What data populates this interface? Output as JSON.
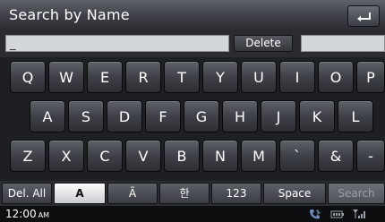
{
  "header": {
    "title": "Search by Name",
    "back_icon": "back-arrow-icon"
  },
  "input": {
    "value": "_",
    "delete_label": "Delete"
  },
  "keyboard": {
    "row1": [
      "Q",
      "W",
      "E",
      "R",
      "T",
      "Y",
      "U",
      "I",
      "O",
      "P"
    ],
    "row2": [
      "A",
      "S",
      "D",
      "F",
      "G",
      "H",
      "J",
      "K",
      "L"
    ],
    "row3": [
      "Z",
      "X",
      "C",
      "V",
      "B",
      "N",
      "M",
      "`",
      "&",
      "-"
    ]
  },
  "modes": {
    "del_all": "Del. All",
    "upper": "A",
    "accented": "Ã",
    "korean": "한",
    "numbers": "123",
    "space": "Space",
    "search": "Search"
  },
  "status": {
    "time": "12:00",
    "ampm": "AM",
    "icons": [
      "bluetooth-phone-icon",
      "battery-icon",
      "signal-icon"
    ]
  }
}
